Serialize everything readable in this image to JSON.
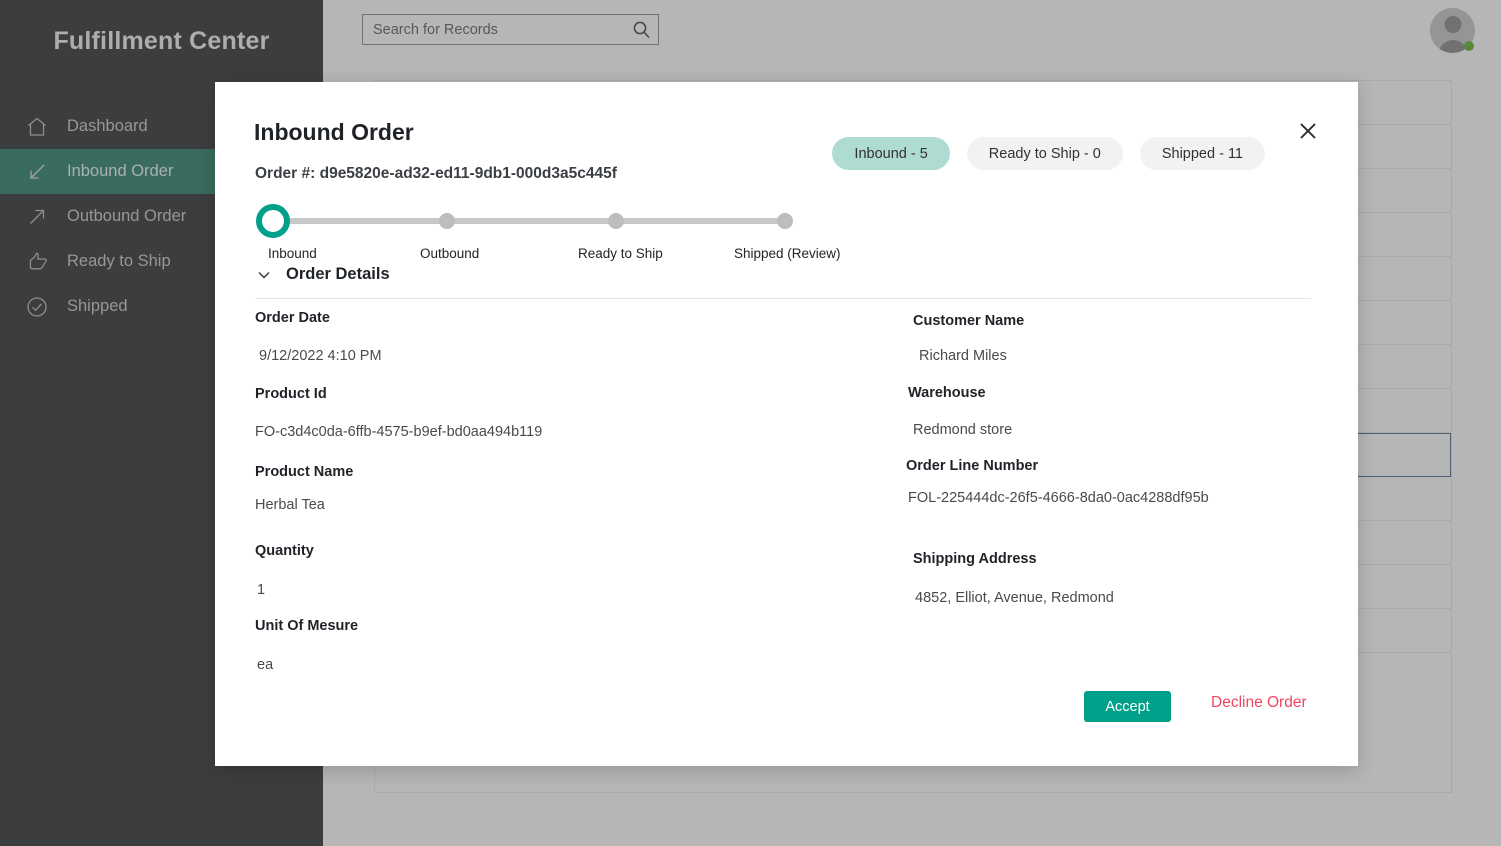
{
  "sidebar": {
    "brand": "Fulfillment Center",
    "items": [
      {
        "label": "Dashboard",
        "icon": "home-icon",
        "active": false
      },
      {
        "label": "Inbound Order",
        "icon": "arrow-inbound-icon",
        "active": true
      },
      {
        "label": "Outbound Order",
        "icon": "arrow-outbound-icon",
        "active": false
      },
      {
        "label": "Ready to Ship",
        "icon": "thumbs-up-icon",
        "active": false
      },
      {
        "label": "Shipped",
        "icon": "check-circle-icon",
        "active": false
      }
    ]
  },
  "topbar": {
    "search_placeholder": "Search for Records",
    "search_value": "",
    "search_icon": "search-icon",
    "avatar_icon": "avatar-person-icon",
    "presence": "online"
  },
  "modal": {
    "title": "Inbound Order",
    "order_number_label": "Order #: d9e5820e-ad32-ed11-9db1-000d3a5c445f",
    "close_icon": "close-icon",
    "pills": [
      {
        "label": "Inbound - 5",
        "active": true
      },
      {
        "label": "Ready to Ship - 0",
        "active": false
      },
      {
        "label": "Shipped - 11",
        "active": false
      }
    ],
    "stepper": {
      "steps": [
        {
          "label": "Inbound",
          "state": "current"
        },
        {
          "label": "Outbound",
          "state": "pending"
        },
        {
          "label": "Ready to Ship",
          "state": "pending"
        },
        {
          "label": "Shipped (Review)",
          "state": "pending"
        }
      ]
    },
    "section": {
      "title": "Order Details",
      "chevron_icon": "chevron-down-icon",
      "expanded": true
    },
    "fields_left": [
      {
        "label": "Order Date",
        "value": "9/12/2022 4:10 PM"
      },
      {
        "label": "Product Id",
        "value": "FO-c3d4c0da-6ffb-4575-b9ef-bd0aa494b119"
      },
      {
        "label": "Product Name",
        "value": "Herbal Tea"
      },
      {
        "label": "Quantity",
        "value": "1"
      },
      {
        "label": "Unit Of Mesure",
        "value": "ea"
      }
    ],
    "fields_right": [
      {
        "label": "Customer Name",
        "value": "Richard Miles"
      },
      {
        "label": "Warehouse",
        "value": "Redmond store"
      },
      {
        "label": "Order Line Number",
        "value": "FOL-225444dc-26f5-4666-8da0-0ac4288df95b"
      },
      {
        "label": "Shipping Address",
        "value": "4852, Elliot, Avenue, Redmond"
      }
    ],
    "accept_label": "Accept",
    "decline_label": "Decline Order"
  },
  "colors": {
    "sidebar_bg": "#2b2f31",
    "sidebar_active": "#2a7f6a",
    "accent_teal": "#00a08a",
    "pill_active": "#afdcd2",
    "decline_red": "#f0455f",
    "presence_green": "#5bb12f",
    "row_selected_border": "#4a6c8f"
  }
}
